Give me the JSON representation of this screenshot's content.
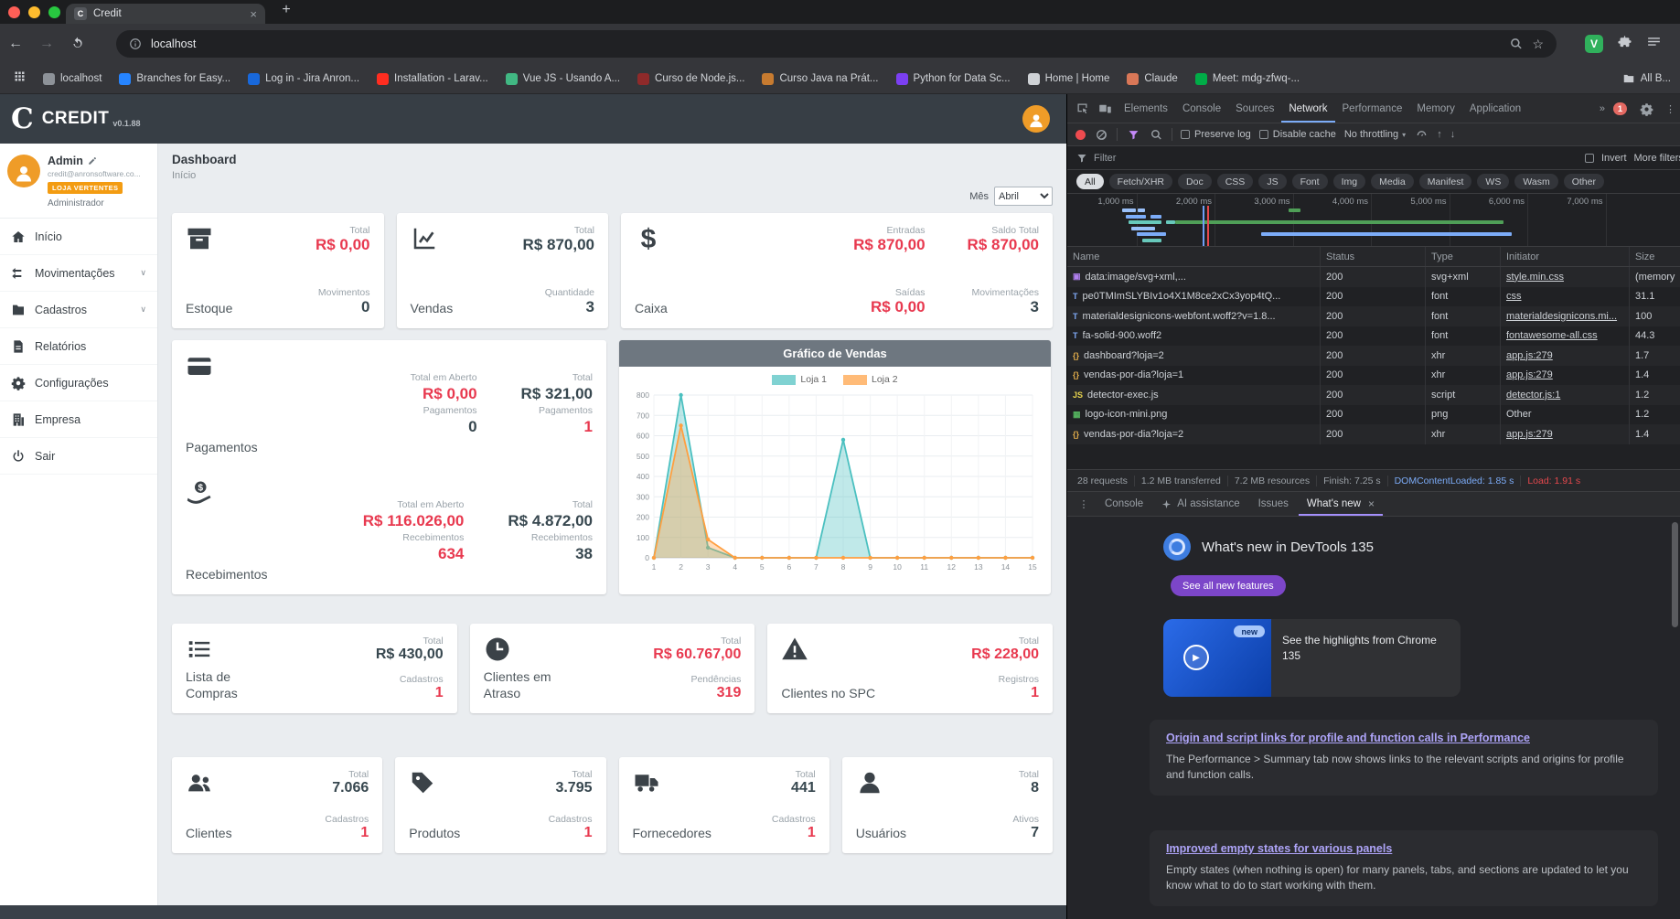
{
  "theme": {
    "accent_red": "#e8394f",
    "value_dark": "#37474f",
    "badge_orange": "#f39c12",
    "avatar_orange": "#ef9c28",
    "devtools_accent": "#7cacf8",
    "whatsnew_purple": "#7c46c9",
    "link_purple": "#aea4f8",
    "ext_green": "#30b15c"
  },
  "glyphs": {
    "close": "×",
    "plus": "+",
    "back": "←",
    "forward": "→",
    "more_tabs": "»",
    "menu_dots": "⋮",
    "caret_down": "▾",
    "chevron_down": "∨",
    "up_arrow": "↑",
    "down_arrow": "↓",
    "star": "☆",
    "play": "▶"
  },
  "browser": {
    "tab_title": "Credit",
    "url": "localhost",
    "extension_badge": "V",
    "bookmarks": [
      {
        "label": "localhost",
        "color": "#8d9298"
      },
      {
        "label": "Branches for Easy...",
        "color": "#2684ff"
      },
      {
        "label": "Log in - Jira Anron...",
        "color": "#1868db"
      },
      {
        "label": "Installation - Larav...",
        "color": "#ff2d20"
      },
      {
        "label": "Vue JS - Usando A...",
        "color": "#41b883"
      },
      {
        "label": "Curso de Node.js...",
        "color": "#8f2a2a"
      },
      {
        "label": "Curso Java na Prát...",
        "color": "#c77b30"
      },
      {
        "label": "Python for Data Sc...",
        "color": "#7b3ff2"
      },
      {
        "label": "Home | Home",
        "color": "#cfd2d6"
      },
      {
        "label": "Claude",
        "color": "#d97757"
      },
      {
        "label": "Meet: mdg-zfwq-...",
        "color": "#00ac47"
      }
    ],
    "all_bookmarks_label": "All B..."
  },
  "app": {
    "header": {
      "logo_letter": "C",
      "logo_text": "CREDIT",
      "version": "v0.1.88"
    },
    "user": {
      "name": "Admin",
      "email": "credit@anronsoftware.co...",
      "badge": "LOJA VERTENTES",
      "role": "Administrador"
    },
    "sidebar": [
      {
        "label": "Início",
        "icon": "home-icon",
        "chevron": false
      },
      {
        "label": "Movimentações",
        "icon": "transfers-icon",
        "chevron": true
      },
      {
        "label": "Cadastros",
        "icon": "records-icon",
        "chevron": true
      },
      {
        "label": "Relatórios",
        "icon": "reports-icon",
        "chevron": false
      },
      {
        "label": "Configurações",
        "icon": "gear-icon",
        "chevron": false
      },
      {
        "label": "Empresa",
        "icon": "company-icon",
        "chevron": false
      },
      {
        "label": "Sair",
        "icon": "power-icon",
        "chevron": false
      }
    ],
    "page_title": "Dashboard",
    "page_subtitle": "Início",
    "month_label": "Mês",
    "month_value": "Abril",
    "cards_row1": [
      {
        "title": "Estoque",
        "icon": "archive-icon",
        "stats": [
          {
            "label": "Total",
            "value": "R$ 0,00",
            "color": "#e8394f"
          },
          {
            "label": "Movimentos",
            "value": "0",
            "color": "#37474f"
          }
        ]
      },
      {
        "title": "Vendas",
        "icon": "chart-icon",
        "stats": [
          {
            "label": "Total",
            "value": "R$ 870,00",
            "color": "#37474f"
          },
          {
            "label": "Quantidade",
            "value": "3",
            "color": "#37474f"
          }
        ]
      },
      {
        "title": "Caixa",
        "icon": "dollar-icon",
        "columns": [
          [
            {
              "label": "Entradas",
              "value": "R$ 870,00",
              "color": "#e8394f"
            },
            {
              "label": "Saídas",
              "value": "R$ 0,00",
              "color": "#e8394f"
            }
          ],
          [
            {
              "label": "Saldo Total",
              "value": "R$ 870,00",
              "color": "#e8394f"
            },
            {
              "label": "Movimentações",
              "value": "3",
              "color": "#37474f"
            }
          ]
        ]
      }
    ],
    "finance_sections": [
      {
        "title": "Pagamentos",
        "icon": "card-icon",
        "cols": [
          {
            "label": "Total em Aberto",
            "value": "R$ 0,00",
            "color": "#e8394f",
            "sublabel": "Pagamentos",
            "subvalue": "0",
            "subcolor": "#37474f"
          },
          {
            "label": "Total",
            "value": "R$ 321,00",
            "color": "#37474f",
            "sublabel": "Pagamentos",
            "subvalue": "1",
            "subcolor": "#e8394f"
          }
        ]
      },
      {
        "title": "Recebimentos",
        "icon": "hand-dollar-icon",
        "cols": [
          {
            "label": "Total em Aberto",
            "value": "R$ 116.026,00",
            "color": "#e8394f",
            "sublabel": "Recebimentos",
            "subvalue": "634",
            "subcolor": "#e8394f"
          },
          {
            "label": "Total",
            "value": "R$ 4.872,00",
            "color": "#37474f",
            "sublabel": "Recebimentos",
            "subvalue": "38",
            "subcolor": "#37474f"
          }
        ]
      }
    ],
    "cards_row3": [
      {
        "title": "Lista de Compras",
        "icon": "list-icon",
        "stats": [
          {
            "label": "Total",
            "value": "R$ 430,00",
            "color": "#37474f"
          },
          {
            "label": "Cadastros",
            "value": "1",
            "color": "#e8394f"
          }
        ]
      },
      {
        "title": "Clientes em Atraso",
        "icon": "clock-icon",
        "stats": [
          {
            "label": "Total",
            "value": "R$ 60.767,00",
            "color": "#e8394f"
          },
          {
            "label": "Pendências",
            "value": "319",
            "color": "#e8394f"
          }
        ]
      },
      {
        "title": "Clientes no SPC",
        "icon": "warning-icon",
        "stats": [
          {
            "label": "Total",
            "value": "R$ 228,00",
            "color": "#e8394f"
          },
          {
            "label": "Registros",
            "value": "1",
            "color": "#e8394f"
          }
        ]
      }
    ],
    "cards_row4": [
      {
        "title": "Clientes",
        "icon": "users-icon",
        "stats": [
          {
            "label": "Total",
            "value": "7.066",
            "color": "#37474f"
          },
          {
            "label": "Cadastros",
            "value": "1",
            "color": "#e8394f"
          }
        ]
      },
      {
        "title": "Produtos",
        "icon": "tag-icon",
        "stats": [
          {
            "label": "Total",
            "value": "3.795",
            "color": "#37474f"
          },
          {
            "label": "Cadastros",
            "value": "1",
            "color": "#e8394f"
          }
        ]
      },
      {
        "title": "Fornecedores",
        "icon": "truck-icon",
        "stats": [
          {
            "label": "Total",
            "value": "441",
            "color": "#37474f"
          },
          {
            "label": "Cadastros",
            "value": "1",
            "color": "#e8394f"
          }
        ]
      },
      {
        "title": "Usuários",
        "icon": "user-icon",
        "stats": [
          {
            "label": "Total",
            "value": "8",
            "color": "#37474f"
          },
          {
            "label": "Ativos",
            "value": "7",
            "color": "#37474f"
          }
        ]
      }
    ]
  },
  "chart_data": {
    "type": "area",
    "title": "Gráfico de Vendas",
    "x": [
      1,
      2,
      3,
      4,
      5,
      6,
      7,
      8,
      9,
      10,
      11,
      12,
      13,
      14,
      15
    ],
    "series": [
      {
        "name": "Loja 1",
        "color": "#4bc0c0",
        "values": [
          0,
          800,
          50,
          0,
          0,
          0,
          0,
          580,
          0,
          0,
          0,
          0,
          0,
          0,
          0
        ]
      },
      {
        "name": "Loja 2",
        "color": "#ff9f40",
        "values": [
          0,
          650,
          90,
          0,
          0,
          0,
          0,
          0,
          0,
          0,
          0,
          0,
          0,
          0,
          0
        ]
      }
    ],
    "ylim": [
      0,
      800
    ],
    "ytick_step": 100,
    "legend_position": "top",
    "grid": true
  },
  "devtools": {
    "tabs": [
      {
        "label": "Elements",
        "active": false
      },
      {
        "label": "Console",
        "active": false
      },
      {
        "label": "Sources",
        "active": false
      },
      {
        "label": "Network",
        "active": true
      },
      {
        "label": "Performance",
        "active": false
      },
      {
        "label": "Memory",
        "active": false
      },
      {
        "label": "Application",
        "active": false
      }
    ],
    "error_badge": "1",
    "toolbar": {
      "preserve_log": "Preserve log",
      "disable_cache": "Disable cache",
      "throttling": "No throttling"
    },
    "filter": {
      "placeholder": "Filter",
      "invert": "Invert",
      "more": "More filters"
    },
    "chips": [
      {
        "label": "All",
        "active": true
      },
      {
        "label": "Fetch/XHR",
        "active": false
      },
      {
        "label": "Doc",
        "active": false
      },
      {
        "label": "CSS",
        "active": false
      },
      {
        "label": "JS",
        "active": false
      },
      {
        "label": "Font",
        "active": false
      },
      {
        "label": "Img",
        "active": false
      },
      {
        "label": "Media",
        "active": false
      },
      {
        "label": "Manifest",
        "active": false
      },
      {
        "label": "WS",
        "active": false
      },
      {
        "label": "Wasm",
        "active": false
      },
      {
        "label": "Other",
        "active": false
      }
    ],
    "overview": {
      "grid_ms": [
        1000,
        2000,
        3000,
        4000,
        5000,
        6000,
        7000
      ],
      "labels": [
        "1,000 ms",
        "2,000 ms",
        "3,000 ms",
        "4,000 ms",
        "5,000 ms",
        "6,000 ms",
        "7,000 ms"
      ],
      "bars": [
        {
          "ms": 820,
          "dur": 180,
          "row": 0,
          "color": "#9ac0f9"
        },
        {
          "ms": 1020,
          "dur": 90,
          "row": 0,
          "color": "#9ac0f9"
        },
        {
          "ms": 860,
          "dur": 260,
          "row": 1,
          "color": "#7cacf8"
        },
        {
          "ms": 1180,
          "dur": 140,
          "row": 1,
          "color": "#7cacf8"
        },
        {
          "ms": 900,
          "dur": 420,
          "row": 2,
          "color": "#67c8bb"
        },
        {
          "ms": 1380,
          "dur": 120,
          "row": 2,
          "color": "#67c8bb"
        },
        {
          "ms": 940,
          "dur": 300,
          "row": 3,
          "color": "#9ac0f9"
        },
        {
          "ms": 1000,
          "dur": 380,
          "row": 4,
          "color": "#7cacf8"
        },
        {
          "ms": 1080,
          "dur": 240,
          "row": 5,
          "color": "#67c8bb"
        },
        {
          "ms": 1500,
          "dur": 4200,
          "row": 2,
          "color": "#4f9f57"
        },
        {
          "ms": 2600,
          "dur": 3200,
          "row": 4,
          "color": "#7cacf8"
        },
        {
          "ms": 2950,
          "dur": 150,
          "row": 0,
          "color": "#4f9f57"
        }
      ],
      "events": [
        {
          "ms": 1850,
          "color": "#6f9ef7"
        },
        {
          "ms": 1910,
          "color": "#e5484d"
        }
      ]
    },
    "table": {
      "columns": [
        "Name",
        "Status",
        "Type",
        "Initiator",
        "Size"
      ],
      "rows": [
        {
          "icon_glyph": "▣",
          "icon_color": "#b180f0",
          "name": "data:image/svg+xml,...",
          "status": "200",
          "type": "svg+xml",
          "initiator": "style.min.css",
          "deco": "underline",
          "size": "(memory"
        },
        {
          "icon_glyph": "T",
          "icon_color": "#7fa9f5",
          "name": "pe0TMImSLYBIv1o4X1M8ce2xCx3yop4tQ...",
          "status": "200",
          "type": "font",
          "initiator": "css",
          "deco": "underline",
          "size": "31.1"
        },
        {
          "icon_glyph": "T",
          "icon_color": "#7fa9f5",
          "name": "materialdesignicons-webfont.woff2?v=1.8...",
          "status": "200",
          "type": "font",
          "initiator": "materialdesignicons.mi...",
          "deco": "underline",
          "size": "100"
        },
        {
          "icon_glyph": "T",
          "icon_color": "#7fa9f5",
          "name": "fa-solid-900.woff2",
          "status": "200",
          "type": "font",
          "initiator": "fontawesome-all.css",
          "deco": "underline",
          "size": "44.3"
        },
        {
          "icon_glyph": "{}",
          "icon_color": "#e0ab4a",
          "name": "dashboard?loja=2",
          "status": "200",
          "type": "xhr",
          "initiator": "app.js:279",
          "deco": "underline",
          "size": "1.7"
        },
        {
          "icon_glyph": "{}",
          "icon_color": "#e0ab4a",
          "name": "vendas-por-dia?loja=1",
          "status": "200",
          "type": "xhr",
          "initiator": "app.js:279",
          "deco": "underline",
          "size": "1.4"
        },
        {
          "icon_glyph": "JS",
          "icon_color": "#e8d44d",
          "name": "detector-exec.js",
          "status": "200",
          "type": "script",
          "initiator": "detector.js:1",
          "deco": "underline",
          "size": "1.2"
        },
        {
          "icon_glyph": "▦",
          "icon_color": "#54b45f",
          "name": "logo-icon-mini.png",
          "status": "200",
          "type": "png",
          "initiator": "Other",
          "deco": "none",
          "size": "1.2"
        },
        {
          "icon_glyph": "{}",
          "icon_color": "#e0ab4a",
          "name": "vendas-por-dia?loja=2",
          "status": "200",
          "type": "xhr",
          "initiator": "app.js:279",
          "deco": "underline",
          "size": "1.4"
        }
      ]
    },
    "summary": {
      "requests": "28 requests",
      "transferred": "1.2 MB transferred",
      "resources": "7.2 MB resources",
      "finish": "Finish: 7.25 s",
      "dcl": "DOMContentLoaded: 1.85 s",
      "load": "Load: 1.91 s"
    },
    "drawer": {
      "tabs": [
        "Console",
        "AI assistance",
        "Issues",
        "What's new"
      ]
    },
    "whats_new": {
      "title": "What's new in DevTools 135",
      "button": "See all new features",
      "highlight_badge": "new",
      "highlight_text": "See the highlights from Chrome 135",
      "articles": [
        {
          "title": "Origin and script links for profile and function calls in Performance",
          "body": "The Performance > Summary tab now shows links to the relevant scripts and origins for profile and function calls."
        },
        {
          "title": "Improved empty states for various panels",
          "body": "Empty states (when nothing is open) for many panels, tabs, and sections are updated to let you know what to do to start working with them."
        }
      ]
    }
  }
}
